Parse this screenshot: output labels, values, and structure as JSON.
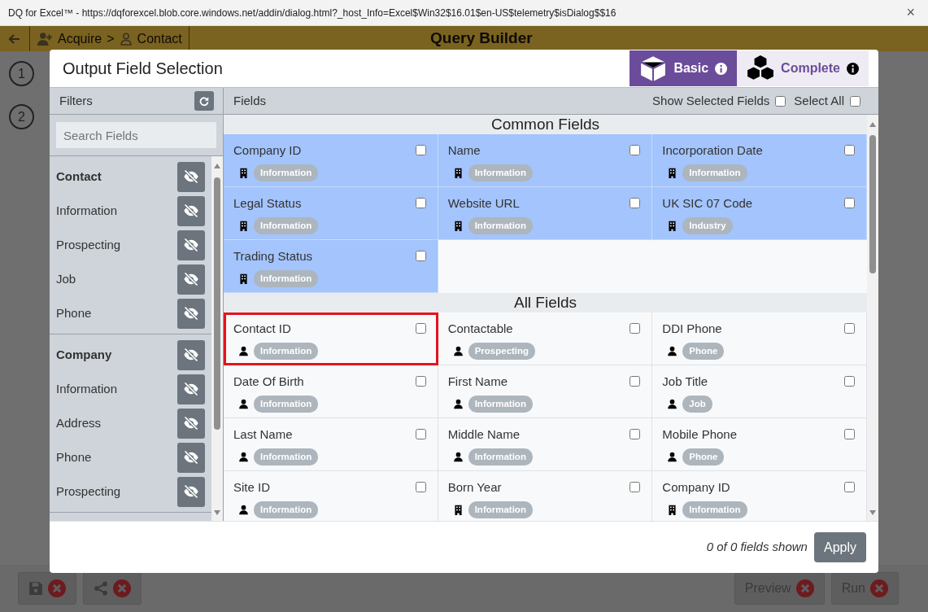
{
  "window": {
    "title": "DQ for Excel™ - https://dqforexcel.blob.core.windows.net/addin/dialog.html?_host_Info=Excel$Win32$16.01$en-US$telemetry$isDialog$$16",
    "close": "×"
  },
  "app": {
    "breadcrumb": [
      "Acquire",
      "Contact"
    ],
    "separator": ">",
    "title": "Query Builder",
    "steps": [
      "1",
      "2"
    ],
    "toolbar_left": [
      {
        "kind": "save"
      },
      {
        "kind": "share"
      }
    ],
    "toolbar_right": [
      {
        "label": "Preview"
      },
      {
        "label": "Run"
      }
    ]
  },
  "dialog": {
    "title": "Output Field Selection",
    "modes": [
      {
        "label": "Basic",
        "kind": "single",
        "selected": true
      },
      {
        "label": "Complete",
        "kind": "multi",
        "selected": false
      }
    ],
    "filters": {
      "title": "Filters",
      "search": {
        "placeholder": "Search Fields"
      },
      "groups": [
        {
          "label": "Contact",
          "items": [
            "Information",
            "Prospecting",
            "Job",
            "Phone"
          ]
        },
        {
          "label": "Company",
          "items": [
            "Information",
            "Address",
            "Phone",
            "Prospecting"
          ]
        }
      ]
    },
    "fields": {
      "title": "Fields",
      "show_selected": {
        "label": "Show Selected Fields",
        "checked": false
      },
      "select_all": {
        "label": "Select All",
        "checked": false
      },
      "sections": [
        {
          "title": "Common Fields",
          "highlight": true,
          "items": [
            {
              "name": "Company ID",
              "kind": "company",
              "category": "Information",
              "checked": false,
              "outlined": false
            },
            {
              "name": "Name",
              "kind": "company",
              "category": "Information",
              "checked": false,
              "outlined": false
            },
            {
              "name": "Incorporation Date",
              "kind": "company",
              "category": "Information",
              "checked": false,
              "outlined": false
            },
            {
              "name": "Legal Status",
              "kind": "company",
              "category": "Information",
              "checked": false,
              "outlined": false
            },
            {
              "name": "Website URL",
              "kind": "company",
              "category": "Information",
              "checked": false,
              "outlined": false
            },
            {
              "name": "UK SIC 07 Code",
              "kind": "company",
              "category": "Industry",
              "checked": false,
              "outlined": false
            },
            {
              "name": "Trading Status",
              "kind": "company",
              "category": "Information",
              "checked": false,
              "outlined": false
            }
          ]
        },
        {
          "title": "All Fields",
          "highlight": false,
          "items": [
            {
              "name": "Contact ID",
              "kind": "contact",
              "category": "Information",
              "checked": false,
              "outlined": true
            },
            {
              "name": "Contactable",
              "kind": "contact",
              "category": "Prospecting",
              "checked": false,
              "outlined": false
            },
            {
              "name": "DDI Phone",
              "kind": "contact",
              "category": "Phone",
              "checked": false,
              "outlined": false
            },
            {
              "name": "Date Of Birth",
              "kind": "contact",
              "category": "Information",
              "checked": false,
              "outlined": false
            },
            {
              "name": "First Name",
              "kind": "contact",
              "category": "Information",
              "checked": false,
              "outlined": false
            },
            {
              "name": "Job Title",
              "kind": "contact",
              "category": "Job",
              "checked": false,
              "outlined": false
            },
            {
              "name": "Last Name",
              "kind": "contact",
              "category": "Information",
              "checked": false,
              "outlined": false
            },
            {
              "name": "Middle Name",
              "kind": "contact",
              "category": "Information",
              "checked": false,
              "outlined": false
            },
            {
              "name": "Mobile Phone",
              "kind": "contact",
              "category": "Phone",
              "checked": false,
              "outlined": false
            },
            {
              "name": "Site ID",
              "kind": "contact",
              "category": "Information",
              "checked": false,
              "outlined": false
            },
            {
              "name": "Born Year",
              "kind": "company",
              "category": "Information",
              "checked": false,
              "outlined": false
            },
            {
              "name": "Company ID",
              "kind": "company",
              "category": "Information",
              "checked": false,
              "outlined": false
            }
          ]
        }
      ]
    },
    "footer": {
      "status": "0 of 0 fields shown",
      "apply": "Apply"
    }
  }
}
